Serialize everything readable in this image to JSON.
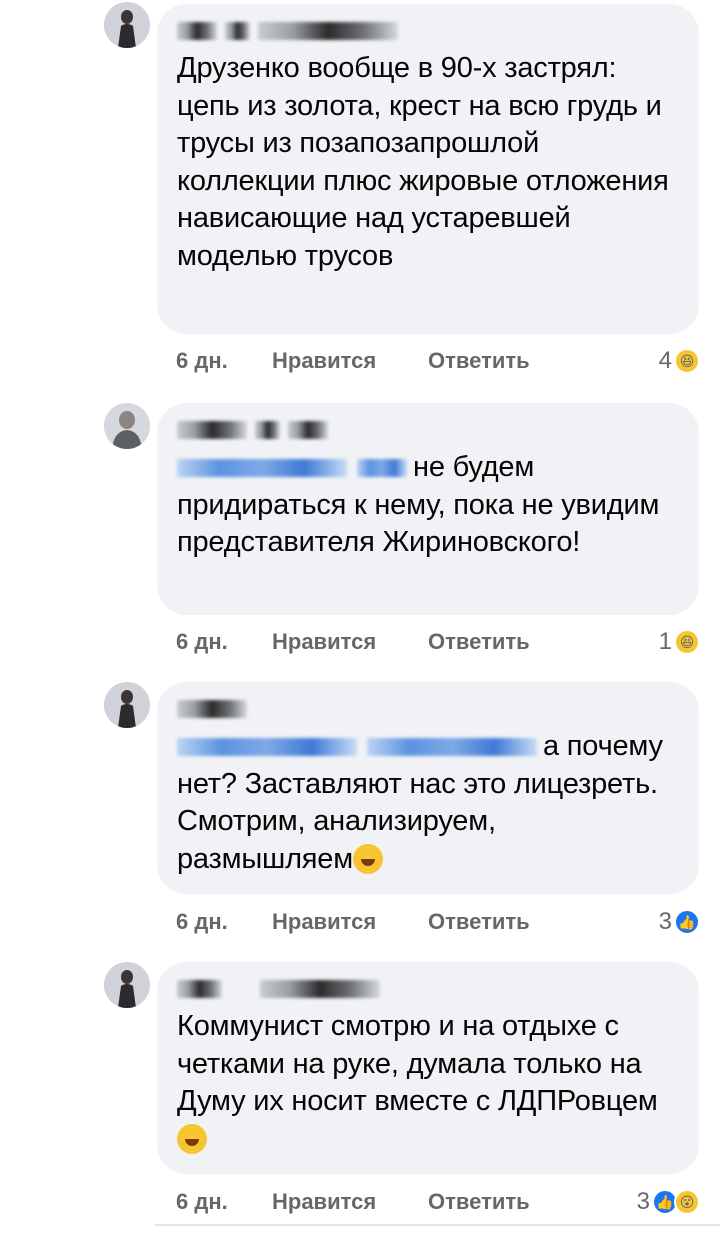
{
  "comments": [
    {
      "text": "Друзенко вообще в 90-х застрял: цепь из золота, крест на всю грудь и трусы из позапозапрошлой коллекции плюс жировые отложения нависающие над устаревшей моделью трусов",
      "time": "6 дн.",
      "like": "Нравится",
      "reply": "Ответить",
      "reaction_count": "4",
      "reactions": [
        "haha-icon"
      ]
    },
    {
      "text": "не будем придираться к нему, пока не увидим представителя Жириновского!",
      "time": "6 дн.",
      "like": "Нравится",
      "reply": "Ответить",
      "reaction_count": "1",
      "reactions": [
        "haha-icon"
      ]
    },
    {
      "text": "а почему нет? Заставляют нас это лицезреть. Смотрим, анализируем, размышляем",
      "time": "6 дн.",
      "like": "Нравится",
      "reply": "Ответить",
      "reaction_count": "3",
      "reactions": [
        "like-icon"
      ]
    },
    {
      "text": "Коммунист смотрю и на отдыхе с четками на руке, думала только на Думу их носит вместе с ЛДПРовцем",
      "time": "6 дн.",
      "like": "Нравится",
      "reply": "Ответить",
      "reaction_count": "3",
      "reactions": [
        "like-icon",
        "wow-icon"
      ]
    }
  ],
  "colors": {
    "bubble": "#f0f2f5",
    "meta": "#65676b",
    "like_blue": "#1877f2",
    "haha_yellow": "#f7c52f"
  }
}
